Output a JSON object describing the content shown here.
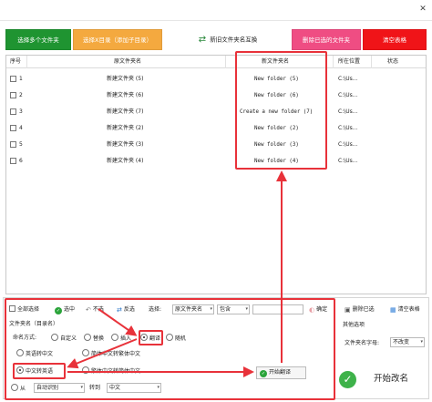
{
  "window": {
    "close_glyph": "✕"
  },
  "toolbar": {
    "select_multiple": "选择多个文件夹",
    "select_folder": "选择X目录（添加子目录）",
    "swap_names": "新旧文件夹名互换",
    "delete_selected": "删除已选的文件夹",
    "clear_table": "清空表格"
  },
  "table": {
    "headers": [
      "序号",
      "原文件夹名",
      "新文件夹名",
      "所在位置",
      "状态"
    ],
    "rows": [
      {
        "index": "1",
        "original": "新建文件夹 (5)",
        "new": "New folder (5)",
        "location": "C:\\Us..."
      },
      {
        "index": "2",
        "original": "新建文件夹 (6)",
        "new": "New folder (6)",
        "location": "C:\\Us..."
      },
      {
        "index": "3",
        "original": "新建文件夹 (7)",
        "new": "Create a new folder (7)",
        "location": "C:\\Us..."
      },
      {
        "index": "4",
        "original": "新建文件夹 (2)",
        "new": "New folder (2)",
        "location": "C:\\Us..."
      },
      {
        "index": "5",
        "original": "新建文件夹 (3)",
        "new": "New folder (3)",
        "location": "C:\\Us..."
      },
      {
        "index": "6",
        "original": "新建文件夹 (4)",
        "new": "New folder (4)",
        "location": "C:\\Us..."
      }
    ]
  },
  "selection_bar": {
    "select_all": "全部选择",
    "select_checked": "选中",
    "unselect": "不选",
    "invert": "反选",
    "select_label": "选择:",
    "filter_field": "原文件夹名",
    "filter_mode": "包含",
    "filter_value": "",
    "confirm": "确定",
    "delete_checked": "删除已选",
    "clear_table": "清空表格"
  },
  "rename_section": {
    "title": "文件夹名（目录名）",
    "mode_label": "命名方式:",
    "modes": [
      "自定义",
      "替换",
      "插入",
      "翻译",
      "随机"
    ],
    "selected_mode": "翻译",
    "options": {
      "en_to_zh": "英语转中文",
      "simp_to_trad": "简体中文转繁体中文",
      "zh_to_en": "中文转英语",
      "trad_to_simp": "繁体中文转简体中文"
    },
    "selected_option": "中文转英语",
    "from_label": "从",
    "from_value": "自动识别",
    "to_label": "转到",
    "to_value": "中文",
    "start_translate": "开始翻译"
  },
  "other_options": {
    "title": "其他选项",
    "case_label": "文件夹名字母:",
    "case_value": "不改变"
  },
  "start_rename": "开始改名",
  "colors": {
    "green_button": "#1f9431",
    "orange_button": "#f4a93f",
    "pink_button": "#ef4d83",
    "red_button": "#f01418",
    "annotation_red": "#e8323a"
  }
}
